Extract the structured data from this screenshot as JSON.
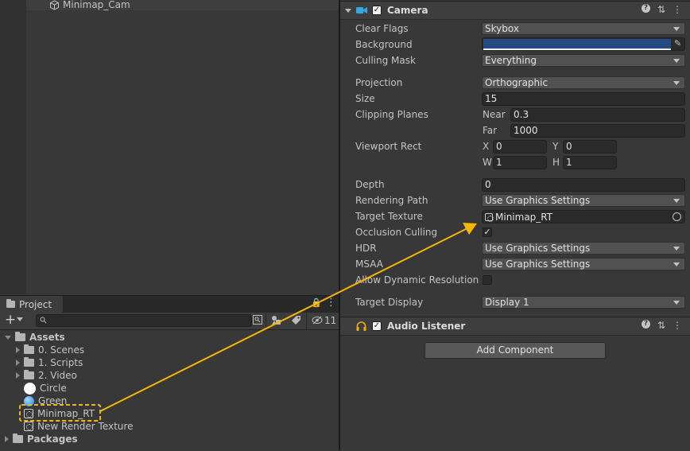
{
  "hierarchy": {
    "item": "Minimap_Cam"
  },
  "project": {
    "tab_label": "Project",
    "hidden_count": "11",
    "tree": [
      {
        "label": "Assets",
        "kind": "folder-open",
        "level": 0
      },
      {
        "label": "0. Scenes",
        "kind": "folder",
        "level": 1
      },
      {
        "label": "1. Scripts",
        "kind": "folder",
        "level": 1
      },
      {
        "label": "2. Video",
        "kind": "folder",
        "level": 1
      },
      {
        "label": "Circle",
        "kind": "circle-white",
        "level": 1
      },
      {
        "label": "Green",
        "kind": "circle-blue",
        "level": 1
      },
      {
        "label": "Minimap_RT",
        "kind": "render-texture",
        "level": 1
      },
      {
        "label": "New Render Texture",
        "kind": "render-texture",
        "level": 1
      },
      {
        "label": "Packages",
        "kind": "folder",
        "level": 0
      }
    ]
  },
  "camera": {
    "title": "Camera",
    "clear_flags": {
      "label": "Clear Flags",
      "value": "Skybox"
    },
    "background": {
      "label": "Background",
      "color": "#234a82"
    },
    "culling_mask": {
      "label": "Culling Mask",
      "value": "Everything"
    },
    "projection": {
      "label": "Projection",
      "value": "Orthographic"
    },
    "size": {
      "label": "Size",
      "value": "15"
    },
    "clipping": {
      "label": "Clipping Planes",
      "near_label": "Near",
      "near": "0.3",
      "far_label": "Far",
      "far": "1000"
    },
    "viewport": {
      "label": "Viewport Rect",
      "x_label": "X",
      "x": "0",
      "y_label": "Y",
      "y": "0",
      "w_label": "W",
      "w": "1",
      "h_label": "H",
      "h": "1"
    },
    "depth": {
      "label": "Depth",
      "value": "0"
    },
    "rendering_path": {
      "label": "Rendering Path",
      "value": "Use Graphics Settings"
    },
    "target_texture": {
      "label": "Target Texture",
      "value": "Minimap_RT"
    },
    "occlusion": {
      "label": "Occlusion Culling",
      "checked": true
    },
    "hdr": {
      "label": "HDR",
      "value": "Use Graphics Settings"
    },
    "msaa": {
      "label": "MSAA",
      "value": "Use Graphics Settings"
    },
    "dyn_res": {
      "label": "Allow Dynamic Resolution",
      "checked": false
    },
    "target_display": {
      "label": "Target Display",
      "value": "Display 1"
    }
  },
  "audio_listener": {
    "title": "Audio Listener"
  },
  "add_component": "Add Component",
  "colors": {
    "accent_arrow": "#f5b800"
  }
}
